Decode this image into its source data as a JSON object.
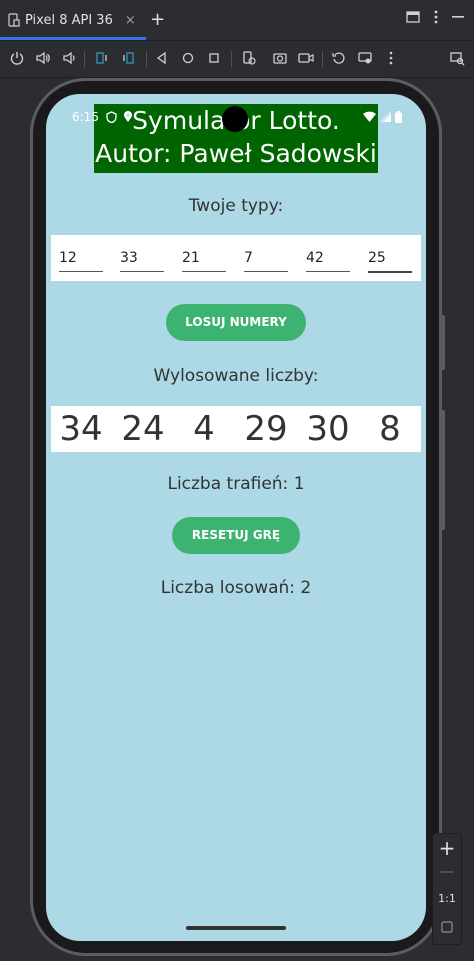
{
  "ide": {
    "tab_label": "Pixel 8 API 36",
    "close_glyph": "×",
    "add_glyph": "+",
    "zoom": {
      "in": "+",
      "out": "—",
      "ratio": "1:1"
    }
  },
  "device": {
    "status_time": "6:15"
  },
  "app": {
    "header_line1": "Symulator Lotto.",
    "header_line2": "Autor: Paweł Sadowski",
    "your_picks_label": "Twoje typy:",
    "picks": [
      "12",
      "33",
      "21",
      "7",
      "42",
      "25"
    ],
    "draw_button": "LOSUJ NUMERY",
    "drawn_label": "Wylosowane liczby:",
    "drawn": [
      "34",
      "24",
      "4",
      "29",
      "30",
      "8"
    ],
    "hits_text": "Liczba trafień: 1",
    "reset_button": "RESETUJ GRĘ",
    "draws_text": "Liczba losowań: 2"
  },
  "colors": {
    "screen_bg": "#add8e6",
    "header_bg": "#006400",
    "button_bg": "#3cb371",
    "ide_bg": "#2b2d30",
    "tab_accent": "#3574f0"
  }
}
